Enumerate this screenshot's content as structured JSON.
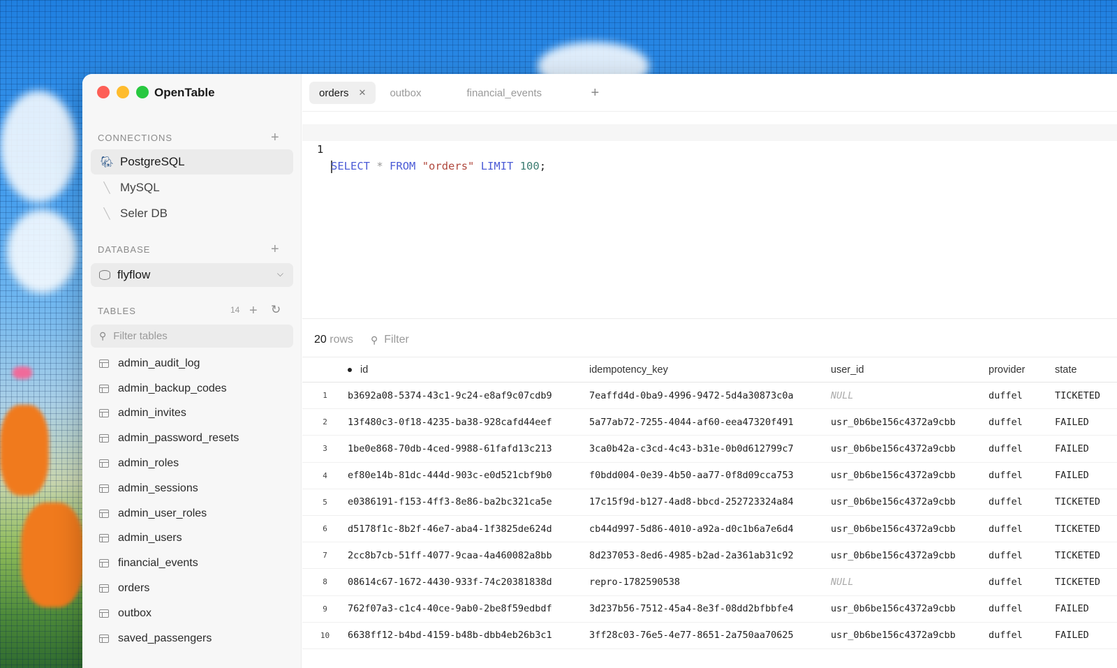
{
  "app": {
    "title": "OpenTable"
  },
  "sidebar": {
    "connections_label": "CONNECTIONS",
    "connections": [
      {
        "label": "PostgreSQL",
        "icon": "postgres-icon",
        "active": true
      },
      {
        "label": "MySQL",
        "icon": "mysql-icon",
        "active": false
      },
      {
        "label": "Seler DB",
        "icon": "mysql-icon",
        "active": false
      }
    ],
    "database_label": "DATABASE",
    "database_selected": "flyflow",
    "tables_label": "TABLES",
    "tables_count": "14",
    "filter_placeholder": "Filter tables",
    "tables": [
      "admin_audit_log",
      "admin_backup_codes",
      "admin_invites",
      "admin_password_resets",
      "admin_roles",
      "admin_sessions",
      "admin_user_roles",
      "admin_users",
      "financial_events",
      "orders",
      "outbox",
      "saved_passengers"
    ]
  },
  "tabs": [
    {
      "label": "orders",
      "active": true
    },
    {
      "label": "outbox",
      "active": false
    },
    {
      "label": "financial_events",
      "active": false
    }
  ],
  "editor": {
    "line_number": "1",
    "tokens": {
      "select": "SELECT",
      "star": "*",
      "from": "FROM",
      "table": "\"orders\"",
      "limit": "LIMIT",
      "count": "100",
      "semicolon": ";"
    },
    "shortcut_hint": "⌘"
  },
  "results": {
    "row_count": "20",
    "rows_word": "rows",
    "filter_label": "Filter",
    "columns": [
      "id",
      "idempotency_key",
      "user_id",
      "provider",
      "state"
    ],
    "rows": [
      {
        "n": "1",
        "id": "b3692a08-5374-43c1-9c24-e8af9c07cdb9",
        "key": "7eaffd4d-0ba9-4996-9472-5d4a30873c0a",
        "user": "NULL",
        "provider": "duffel",
        "state": "TICKETED"
      },
      {
        "n": "2",
        "id": "13f480c3-0f18-4235-ba38-928cafd44eef",
        "key": "5a77ab72-7255-4044-af60-eea47320f491",
        "user": "usr_0b6be156c4372a9cbb",
        "provider": "duffel",
        "state": "FAILED"
      },
      {
        "n": "3",
        "id": "1be0e868-70db-4ced-9988-61fafd13c213",
        "key": "3ca0b42a-c3cd-4c43-b31e-0b0d612799c7",
        "user": "usr_0b6be156c4372a9cbb",
        "provider": "duffel",
        "state": "FAILED"
      },
      {
        "n": "4",
        "id": "ef80e14b-81dc-444d-903c-e0d521cbf9b0",
        "key": "f0bdd004-0e39-4b50-aa77-0f8d09cca753",
        "user": "usr_0b6be156c4372a9cbb",
        "provider": "duffel",
        "state": "FAILED"
      },
      {
        "n": "5",
        "id": "e0386191-f153-4ff3-8e86-ba2bc321ca5e",
        "key": "17c15f9d-b127-4ad8-bbcd-252723324a84",
        "user": "usr_0b6be156c4372a9cbb",
        "provider": "duffel",
        "state": "TICKETED"
      },
      {
        "n": "6",
        "id": "d5178f1c-8b2f-46e7-aba4-1f3825de624d",
        "key": "cb44d997-5d86-4010-a92a-d0c1b6a7e6d4",
        "user": "usr_0b6be156c4372a9cbb",
        "provider": "duffel",
        "state": "TICKETED"
      },
      {
        "n": "7",
        "id": "2cc8b7cb-51ff-4077-9caa-4a460082a8bb",
        "key": "8d237053-8ed6-4985-b2ad-2a361ab31c92",
        "user": "usr_0b6be156c4372a9cbb",
        "provider": "duffel",
        "state": "TICKETED"
      },
      {
        "n": "8",
        "id": "08614c67-1672-4430-933f-74c20381838d",
        "key": "repro-1782590538",
        "user": "NULL",
        "provider": "duffel",
        "state": "TICKETED"
      },
      {
        "n": "9",
        "id": "762f07a3-c1c4-40ce-9ab0-2be8f59edbdf",
        "key": "3d237b56-7512-45a4-8e3f-08dd2bfbbfe4",
        "user": "usr_0b6be156c4372a9cbb",
        "provider": "duffel",
        "state": "FAILED"
      },
      {
        "n": "10",
        "id": "6638ff12-b4bd-4159-b48b-dbb4eb26b3c1",
        "key": "3ff28c03-76e5-4e77-8651-2a750aa70625",
        "user": "usr_0b6be156c4372a9cbb",
        "provider": "duffel",
        "state": "FAILED"
      }
    ]
  },
  "colors": {
    "traffic_red": "#fd5f57",
    "traffic_yellow": "#febc2e",
    "traffic_green": "#28c840",
    "keyword": "#4b5bd6",
    "string": "#b0483d",
    "number": "#3c7d72"
  }
}
